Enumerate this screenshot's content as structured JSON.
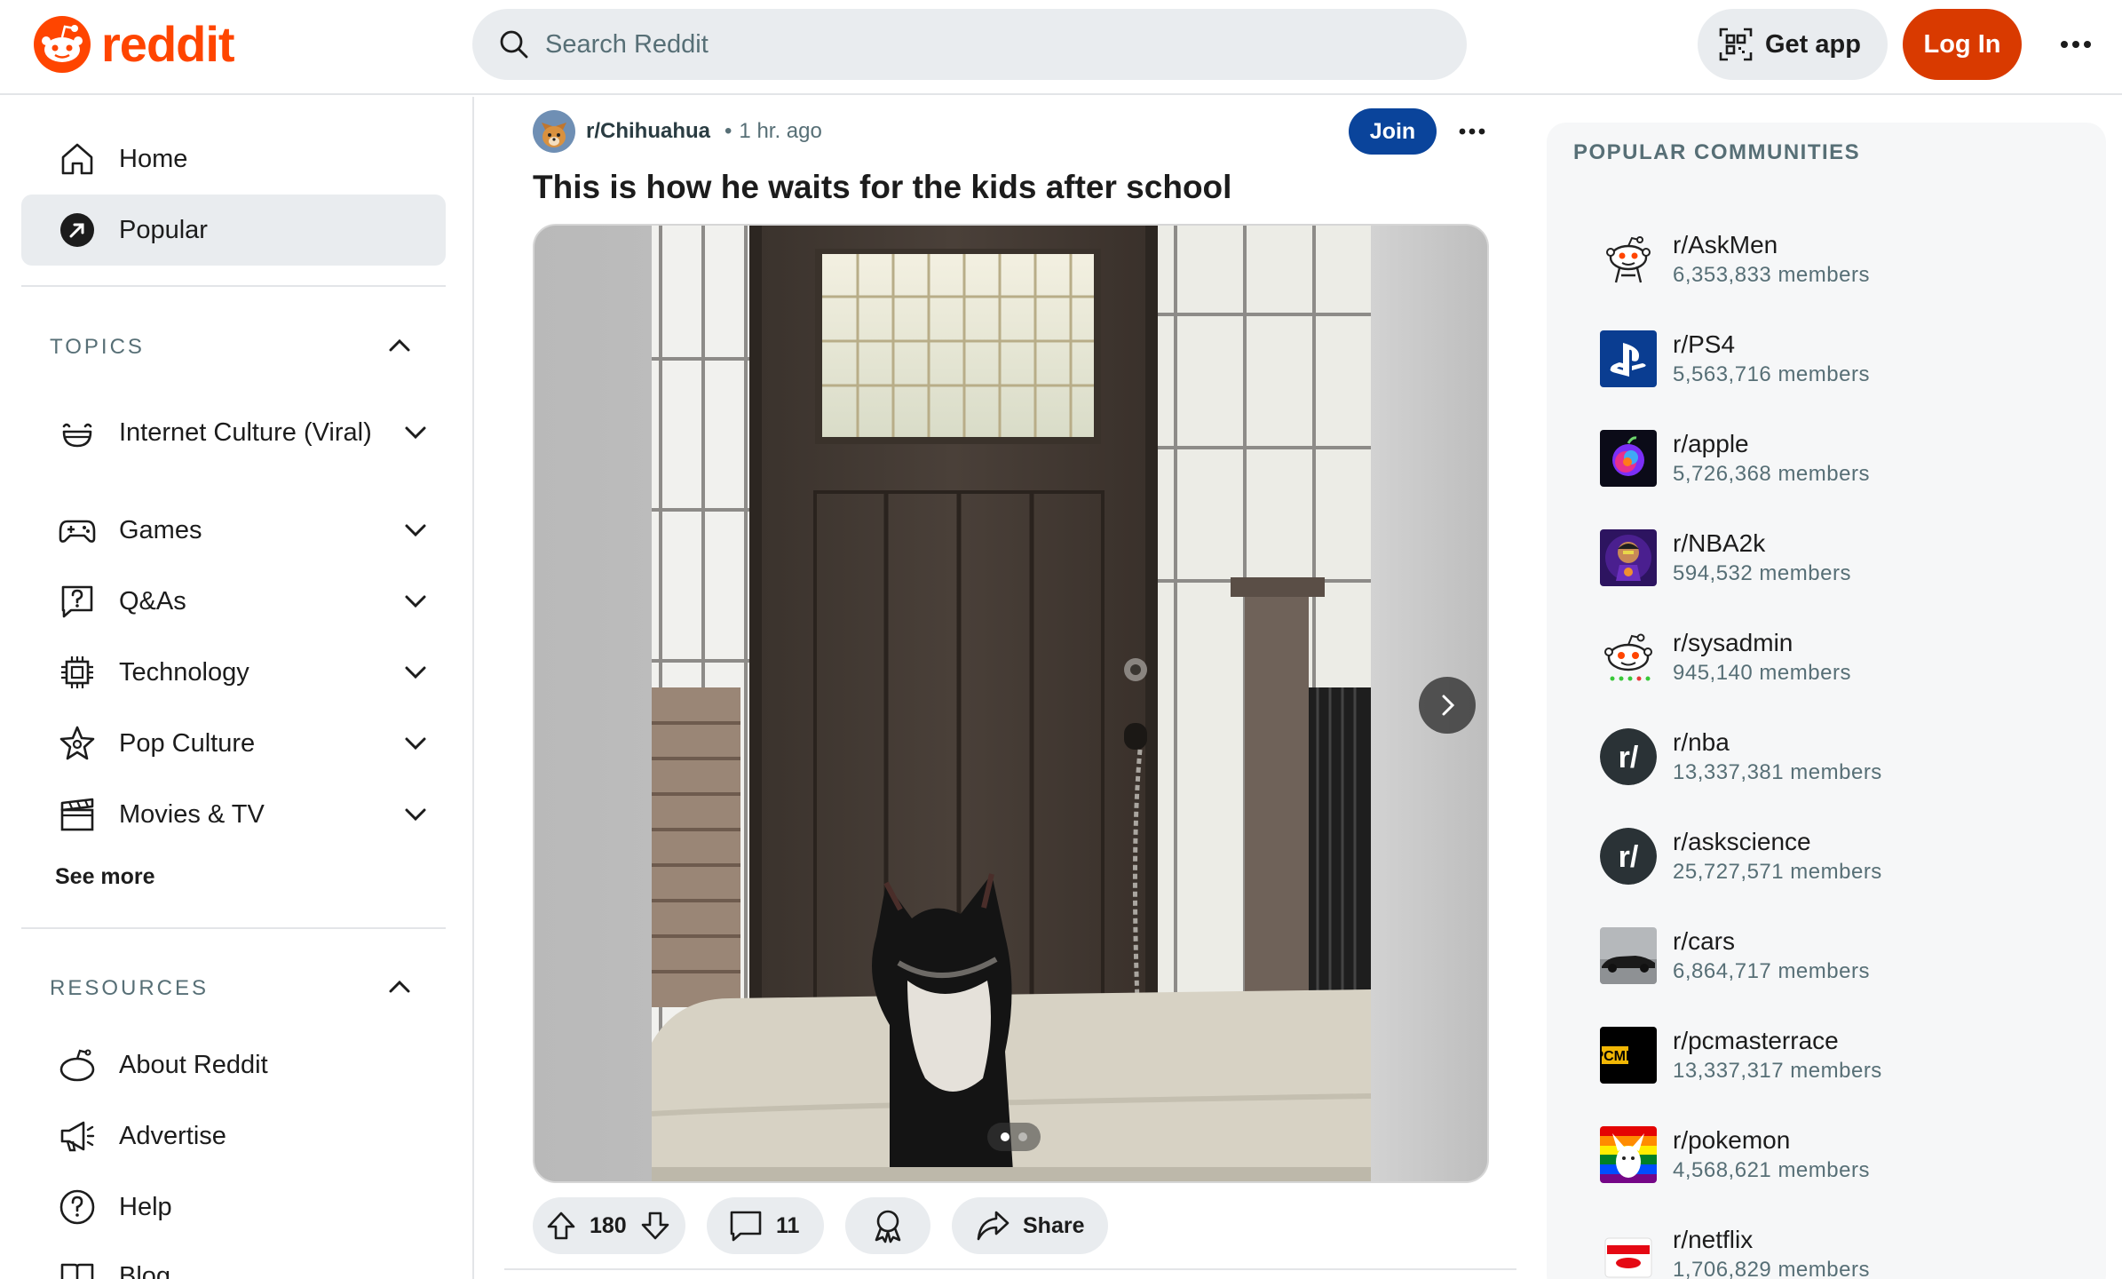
{
  "header": {
    "logo_text": "reddit",
    "search_placeholder": "Search Reddit",
    "get_app_label": "Get app",
    "login_label": "Log In",
    "brand_color": "#ff4500"
  },
  "sidebar": {
    "nav": [
      {
        "label": "Home",
        "icon": "home-icon"
      },
      {
        "label": "Popular",
        "icon": "popular-icon",
        "active": true
      }
    ],
    "topics_title": "TOPICS",
    "topics": [
      {
        "label": "Internet Culture (Viral)",
        "icon": "smile-icon"
      },
      {
        "label": "Games",
        "icon": "gamepad-icon"
      },
      {
        "label": "Q&As",
        "icon": "question-bubble-icon"
      },
      {
        "label": "Technology",
        "icon": "chip-icon"
      },
      {
        "label": "Pop Culture",
        "icon": "star-icon"
      },
      {
        "label": "Movies & TV",
        "icon": "clapperboard-icon"
      }
    ],
    "see_more": "See more",
    "resources_title": "RESOURCES",
    "resources": [
      {
        "label": "About Reddit",
        "icon": "reddit-alien-icon"
      },
      {
        "label": "Advertise",
        "icon": "megaphone-icon"
      },
      {
        "label": "Help",
        "icon": "help-icon"
      },
      {
        "label": "Blog",
        "icon": "book-icon"
      }
    ]
  },
  "post": {
    "subreddit": "r/Chihuahua",
    "separator": "•",
    "time": "1 hr. ago",
    "join_label": "Join",
    "title": "This is how he waits for the kids after school",
    "carousel": {
      "current": 1,
      "total": 2
    },
    "votes": "180",
    "comments": "11",
    "share_label": "Share"
  },
  "popular_communities": {
    "title": "POPULAR COMMUNITIES",
    "items": [
      {
        "name": "r/AskMen",
        "members": "6,353,833 members",
        "icon": "askmen-snoo-icon"
      },
      {
        "name": "r/PS4",
        "members": "5,563,716 members",
        "icon": "playstation-icon"
      },
      {
        "name": "r/apple",
        "members": "5,726,368 members",
        "icon": "apple-swirl-icon"
      },
      {
        "name": "r/NBA2k",
        "members": "594,532 members",
        "icon": "nba2k-icon"
      },
      {
        "name": "r/sysadmin",
        "members": "945,140 members",
        "icon": "sysadmin-snoo-icon"
      },
      {
        "name": "r/nba",
        "members": "13,337,381 members",
        "icon": "default-community-icon"
      },
      {
        "name": "r/askscience",
        "members": "25,727,571 members",
        "icon": "default-community-icon"
      },
      {
        "name": "r/cars",
        "members": "6,864,717 members",
        "icon": "car-icon"
      },
      {
        "name": "r/pcmasterrace",
        "members": "13,337,317 members",
        "icon": "pcmr-icon",
        "badge_text": "PCMR"
      },
      {
        "name": "r/pokemon",
        "members": "4,568,621 members",
        "icon": "pokemon-icon"
      },
      {
        "name": "r/netflix",
        "members": "1,706,829 members",
        "icon": "netflix-icon"
      }
    ]
  }
}
